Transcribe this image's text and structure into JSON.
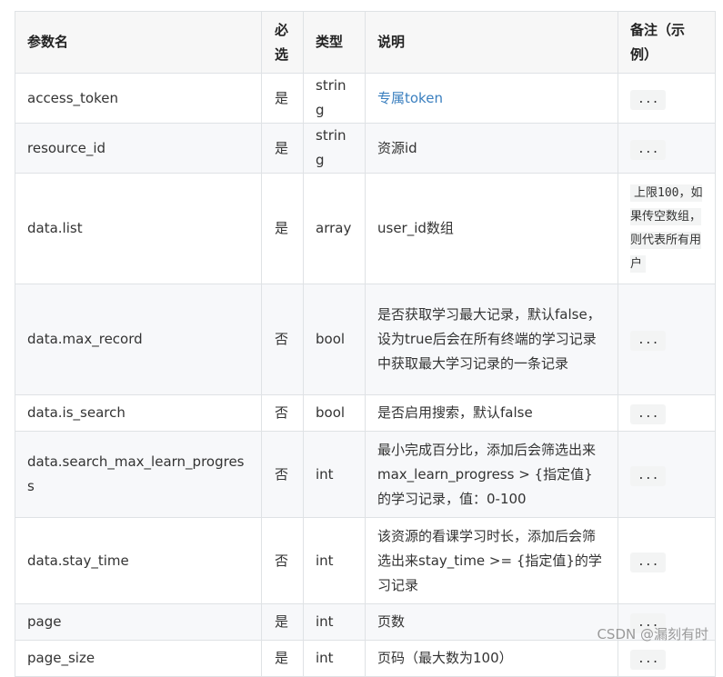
{
  "table": {
    "headers": {
      "name": "参数名",
      "required": "必选",
      "type": "类型",
      "description": "说明",
      "note": "备注（示例）"
    },
    "rows": [
      {
        "name": "access_token",
        "required": "是",
        "type": "string",
        "description": "专属token",
        "note": "..."
      },
      {
        "name": "resource_id",
        "required": "是",
        "type": "string",
        "description": "资源id",
        "note": "..."
      },
      {
        "name": "data.list",
        "required": "是",
        "type": "array",
        "description": "user_id数组",
        "note": "上限100，如果传空数组，则代表所有用户"
      },
      {
        "name": "data.max_record",
        "required": "否",
        "type": "bool",
        "description": "是否获取学习最大记录，默认false，设为true后会在所有终端的学习记录中获取最大学习记录的一条记录",
        "note": "..."
      },
      {
        "name": "data.is_search",
        "required": "否",
        "type": "bool",
        "description": "是否启用搜索，默认false",
        "note": "..."
      },
      {
        "name": "data.search_max_learn_progress",
        "required": "否",
        "type": "int",
        "description": "最小完成百分比，添加后会筛选出来max_learn_progress > {指定值}的学习记录，值：0-100",
        "note": "..."
      },
      {
        "name": "data.stay_time",
        "required": "否",
        "type": "int",
        "description": "该资源的看课学习时长，添加后会筛选出来stay_time >= {指定值}的学习记录",
        "note": "..."
      },
      {
        "name": "page",
        "required": "是",
        "type": "int",
        "description": "页数",
        "note": "..."
      },
      {
        "name": "page_size",
        "required": "是",
        "type": "int",
        "description": "页码（最大数为100）",
        "note": "..."
      }
    ]
  },
  "watermark": "CSDN @漏刻有时"
}
